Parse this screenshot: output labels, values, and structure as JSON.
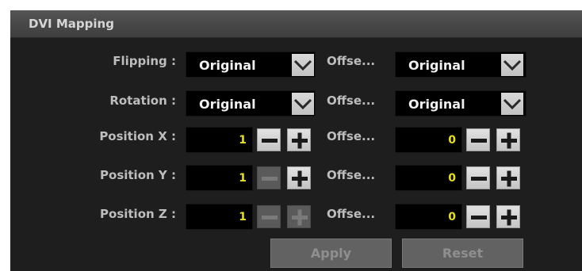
{
  "window": {
    "title": "DVI Mapping"
  },
  "colors": {
    "panel_bg": "#1e1e1e",
    "value_yellow": "#e8e01a",
    "label_gray": "#bdbdbd"
  },
  "rows": [
    {
      "label": "Flipping :",
      "value": "Original",
      "offset_label": "Offse...",
      "offset_value": "Original"
    },
    {
      "label": "Rotation :",
      "value": "Original",
      "offset_label": "Offse...",
      "offset_value": "Original"
    },
    {
      "label": "Position X :",
      "value": "1",
      "offset_label": "Offse...",
      "offset_value": "0"
    },
    {
      "label": "Position Y :",
      "value": "1",
      "offset_label": "Offse...",
      "offset_value": "0"
    },
    {
      "label": "Position Z :",
      "value": "1",
      "offset_label": "Offse...",
      "offset_value": "0"
    }
  ],
  "buttons": {
    "apply": "Apply",
    "reset": "Reset"
  },
  "icons": {
    "dropdown": "chevron-down-icon",
    "decrement": "minus-icon",
    "increment": "plus-icon"
  }
}
